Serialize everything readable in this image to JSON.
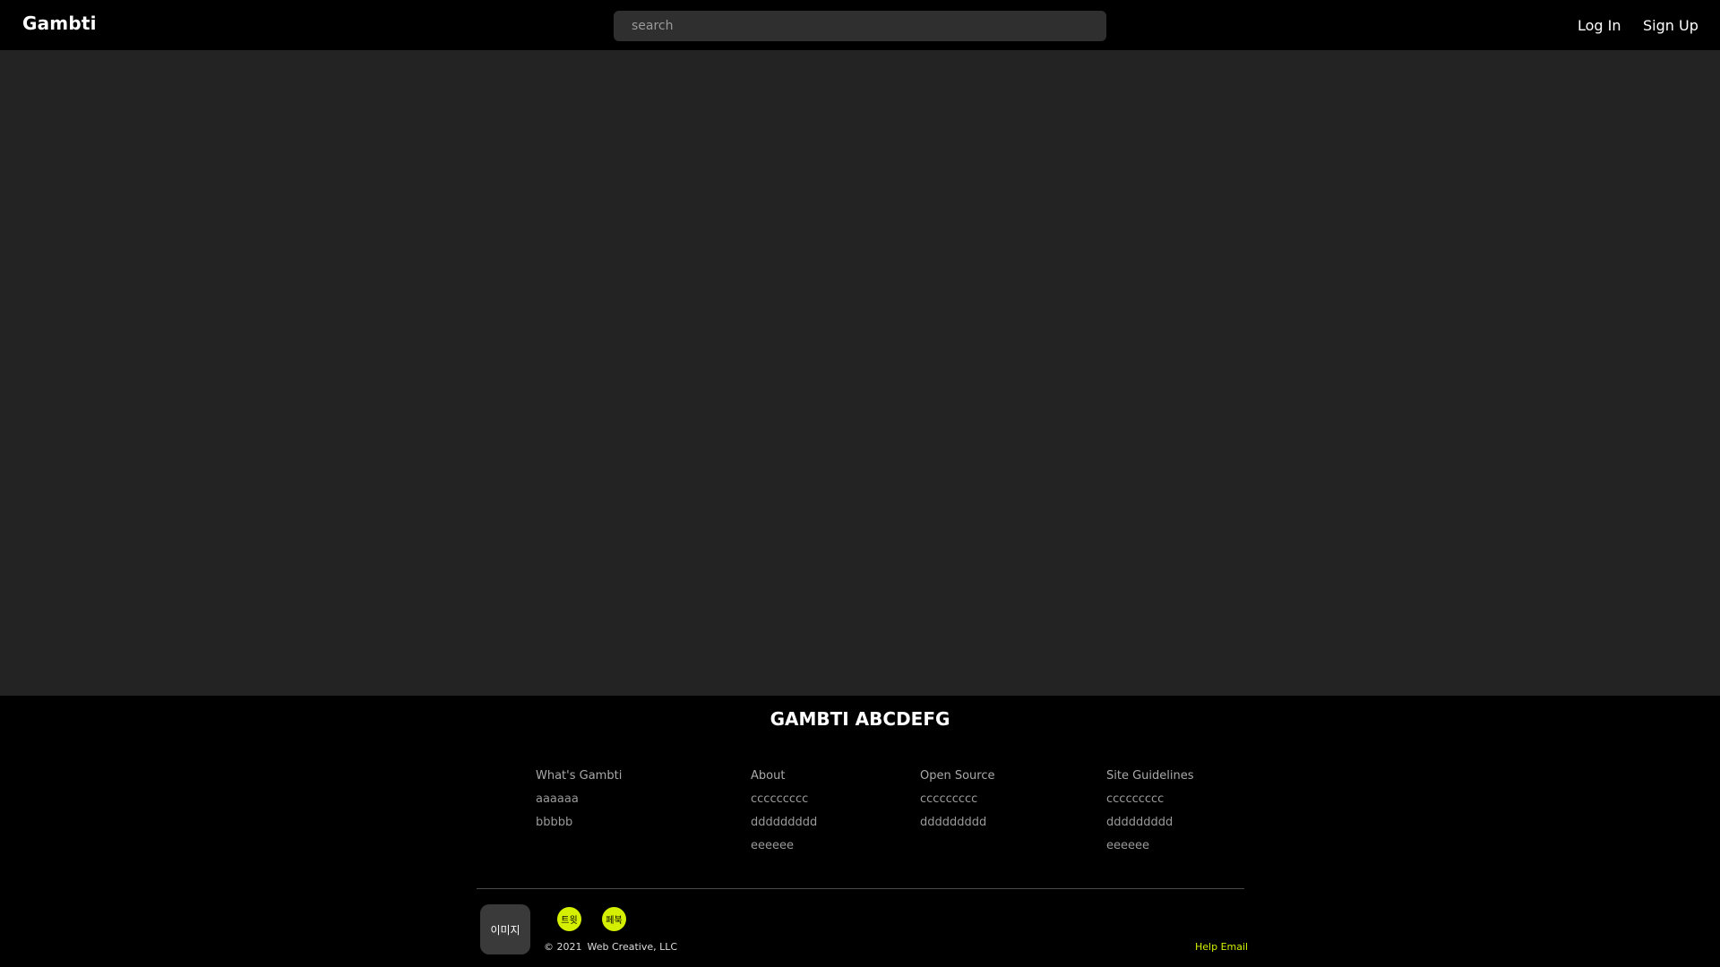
{
  "header": {
    "logo": "Gambti",
    "search_placeholder": "search",
    "login_label": "Log In",
    "signup_label": "Sign Up"
  },
  "footer": {
    "title": "GAMBTI ABCDEFG",
    "columns": [
      {
        "heading": "What's Gambti",
        "items": [
          "aaaaaa",
          "bbbbb"
        ]
      },
      {
        "heading": "About",
        "items": [
          "ccccccccc",
          "ddddddddd",
          "eeeeee"
        ]
      },
      {
        "heading": "Open Source",
        "items": [
          "ccccccccc",
          "ddddddddd"
        ]
      },
      {
        "heading": "Site Guidelines",
        "items": [
          "ccccccccc",
          "ddddddddd",
          "eeeeee"
        ]
      }
    ],
    "image_label": "이미지",
    "social": [
      {
        "label": "트윗",
        "icon": "twitter-icon"
      },
      {
        "label": "페북",
        "icon": "facebook-icon"
      }
    ],
    "copyright_symbol_year": "© 2021",
    "copyright_company": "Web Creative, LLC",
    "help_email_label": "Help Email"
  },
  "colors": {
    "background": "#232323",
    "bar": "#000000",
    "accent": "#d4f000"
  }
}
